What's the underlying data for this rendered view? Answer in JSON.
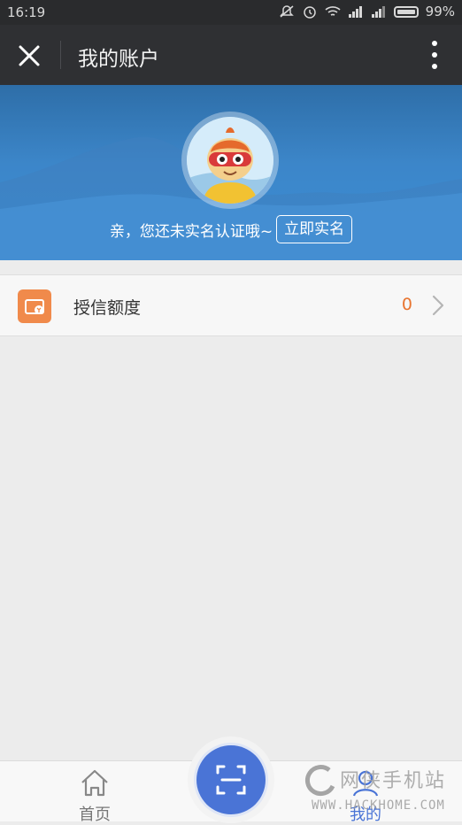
{
  "status_bar": {
    "time": "16:19",
    "battery": "99%"
  },
  "nav": {
    "title": "我的账户"
  },
  "banner": {
    "prompt": "亲，您还未实名认证哦~",
    "verify_button": "立即实名"
  },
  "credit": {
    "label": "授信额度",
    "value": "0"
  },
  "tabs": {
    "home": "首页",
    "mine": "我的"
  },
  "watermark": {
    "name": "网侠手机站",
    "domain": "WWW.HACKHOME.COM"
  },
  "colors": {
    "accent": "#4a74d6",
    "credit_icon": "#f08a4b",
    "value": "#e8742f"
  }
}
